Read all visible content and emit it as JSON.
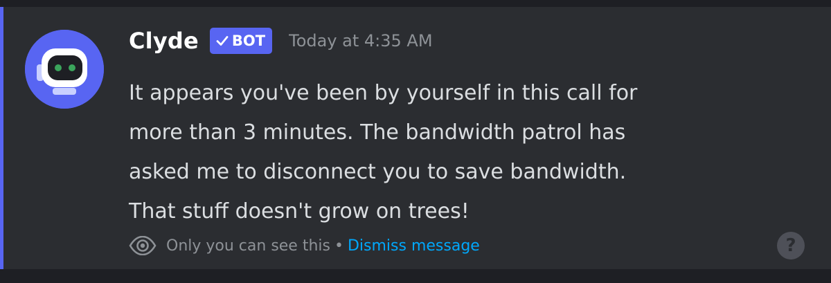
{
  "message": {
    "author": "Clyde",
    "bot_tag": {
      "label": "BOT",
      "verified_icon": "check-icon",
      "color": "#5865f2"
    },
    "timestamp": "Today at 4:35 AM",
    "content": "It appears you've been by yourself in this call for\nmore than 3 minutes. The bandwidth patrol has\nasked me to disconnect you to save bandwidth.\nThat stuff doesn't grow on trees!",
    "avatar_icon": "robot-icon",
    "accent_color": "#5865f2"
  },
  "footer": {
    "eye_icon": "eye-icon",
    "notice": "Only you can see this",
    "separator": "•",
    "dismiss_label": "Dismiss message",
    "dismiss_color": "#00a8fc"
  },
  "help": {
    "icon": "help-icon",
    "glyph": "?"
  }
}
